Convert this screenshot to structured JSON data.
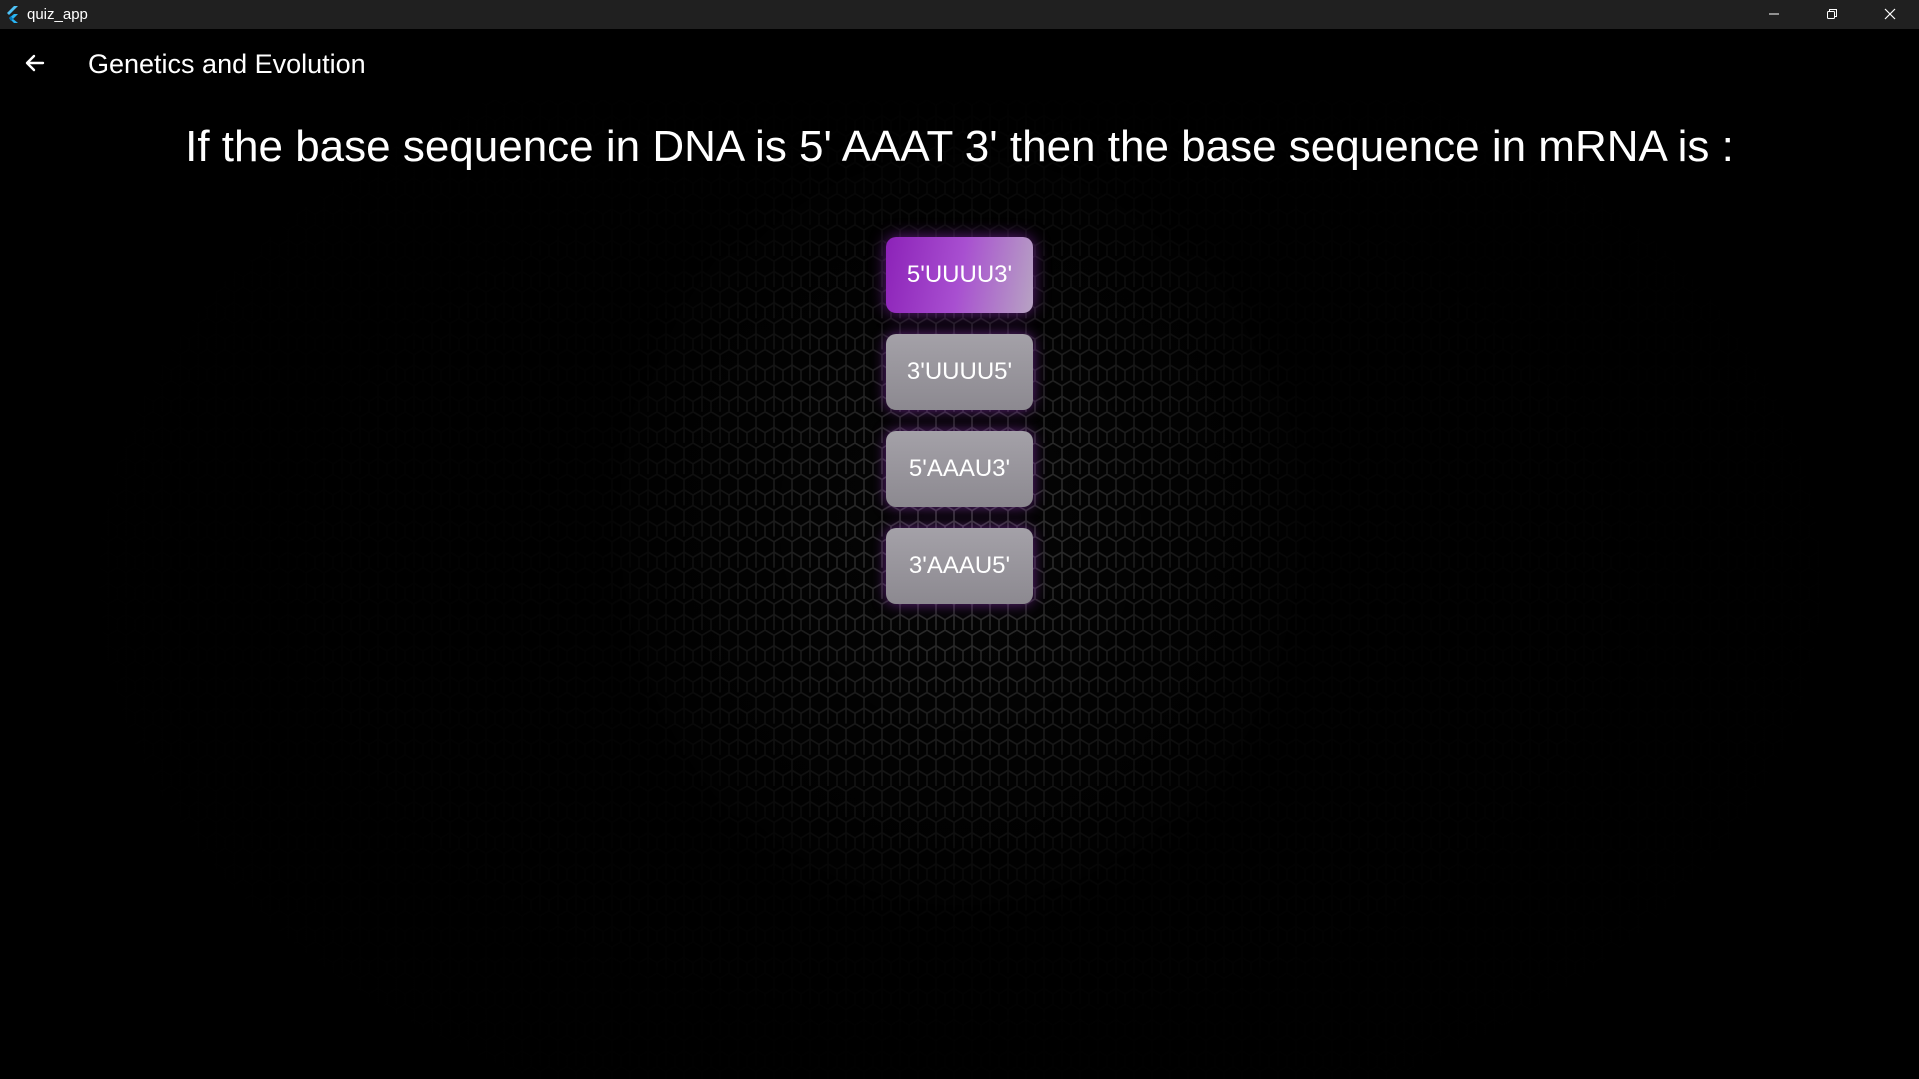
{
  "window": {
    "app_name": "quiz_app",
    "icon": "flutter-logo-icon",
    "controls": [
      "minimize-icon",
      "restore-icon",
      "close-icon"
    ]
  },
  "appbar": {
    "back_icon": "arrow-left-icon",
    "title": "Genetics and Evolution"
  },
  "quiz": {
    "question": "If the base sequence in DNA is 5' AAAT 3' then the base sequence in mRNA is :",
    "options": [
      {
        "label": "5'UUUU3'",
        "selected": true
      },
      {
        "label": "3'UUUU5'",
        "selected": false
      },
      {
        "label": "5'AAAU3'",
        "selected": false
      },
      {
        "label": "3'AAAU5'",
        "selected": false
      }
    ]
  },
  "colors": {
    "selected_accent": "#8c22b8",
    "option_bg": "#9a979e",
    "glow": "#aa3cdc",
    "background": "#000000",
    "titlebar": "#202020"
  }
}
